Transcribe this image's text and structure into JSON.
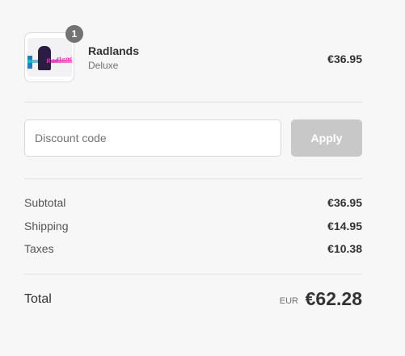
{
  "product": {
    "quantity": "1",
    "name": "Radlands",
    "variant": "Deluxe",
    "price": "€36.95",
    "image_text": "Radlands"
  },
  "discount": {
    "placeholder": "Discount code",
    "value": "",
    "apply_label": "Apply"
  },
  "summary": {
    "lines": [
      {
        "label": "Subtotal",
        "value": "€36.95"
      },
      {
        "label": "Shipping",
        "value": "€14.95"
      },
      {
        "label": "Taxes",
        "value": "€10.38"
      }
    ],
    "total_label": "Total",
    "currency": "EUR",
    "total_value": "€62.28"
  }
}
